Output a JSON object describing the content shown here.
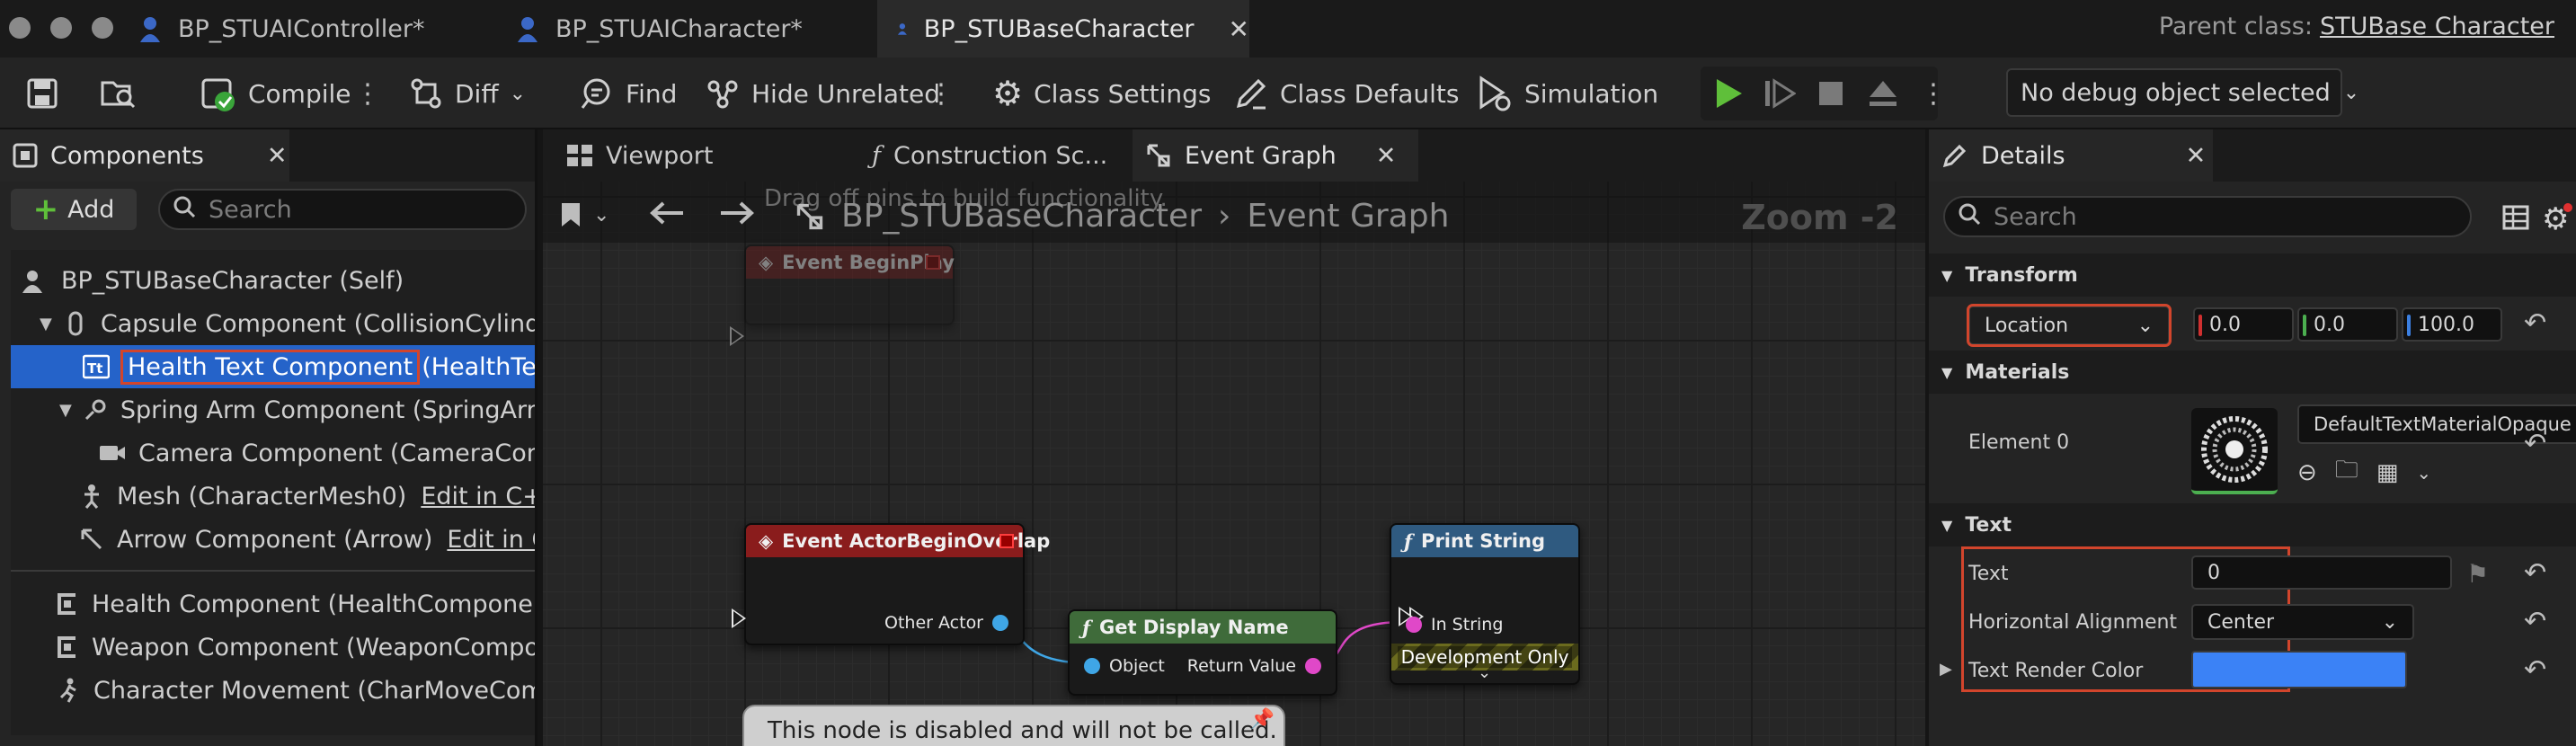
{
  "titlebar": {
    "tabs": [
      {
        "label": "BP_STUAIController*"
      },
      {
        "label": "BP_STUAICharacter*"
      },
      {
        "label": "BP_STUBaseCharacter"
      }
    ],
    "parent_label": "Parent class:",
    "parent_value": "STUBase Character"
  },
  "toolbar": {
    "compile": "Compile",
    "diff": "Diff",
    "find": "Find",
    "hide_unrelated": "Hide Unrelated",
    "class_settings": "Class Settings",
    "class_defaults": "Class Defaults",
    "simulation": "Simulation",
    "debug_object": "No debug object selected"
  },
  "components": {
    "title": "Components",
    "add": "Add",
    "search_placeholder": "Search",
    "items": [
      {
        "label": "BP_STUBaseCharacter (Self)"
      },
      {
        "label": "Capsule Component (CollisionCylinder)"
      },
      {
        "label": "Health Text Component",
        "sub": "(HealthTextComponent)"
      },
      {
        "label": "Spring Arm Component (SpringArmComponent)"
      },
      {
        "label": "Camera Component (CameraComponent)"
      },
      {
        "label": "Mesh (CharacterMesh0)",
        "edit": "Edit in C++"
      },
      {
        "label": "Arrow Component (Arrow)",
        "edit": "Edit in C++"
      },
      {
        "label": "Health Component (HealthComponent)"
      },
      {
        "label": "Weapon Component (WeaponComponent)"
      },
      {
        "label": "Character Movement (CharMoveComp)"
      }
    ]
  },
  "graph": {
    "tabs": [
      "Viewport",
      "Construction Sc...",
      "Event Graph"
    ],
    "breadcrumb_root": "BP_STUBaseCharacter",
    "breadcrumb_leaf": "Event Graph",
    "zoom": "Zoom -2",
    "hint": "Drag off pins to build functionality.",
    "nodes": {
      "begin_play": "Event BeginPlay",
      "begin_overlap": "Event ActorBeginOverlap",
      "other_actor": "Other Actor",
      "get_display_name": "Get Display Name",
      "object": "Object",
      "return_value": "Return Value",
      "print_string": "Print String",
      "in_string": "In String",
      "dev_only": "Development Only",
      "disabled_comment": "This node is disabled and will not be called."
    }
  },
  "details": {
    "title": "Details",
    "search_placeholder": "Search",
    "transform": "Transform",
    "location": "Location",
    "loc_x": "0.0",
    "loc_y": "0.0",
    "loc_z": "100.0",
    "materials": "Materials",
    "element0": "Element 0",
    "material_name": "DefaultTextMaterialOpaque",
    "text_section": "Text",
    "text_label": "Text",
    "text_value": "0",
    "halign_label": "Horizontal Alignment",
    "halign_value": "Center",
    "render_color_label": "Text Render Color",
    "render_color": "#3b82f6"
  },
  "colors": {
    "selection": "#2563c9",
    "highlight_box": "#d2452c",
    "event_header": "#8a1c1c",
    "pure_header": "#3f6b3a",
    "function_header": "#2f5a80"
  }
}
